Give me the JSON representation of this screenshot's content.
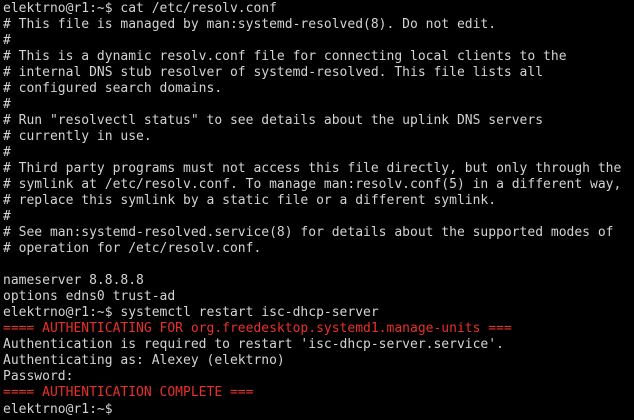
{
  "terminal": {
    "lines": [
      {
        "text": "elektrno@r1:~$ cat /etc/resolv.conf",
        "color": "#d3d3d3"
      },
      {
        "text": "# This file is managed by man:systemd-resolved(8). Do not edit.",
        "color": "#d3d3d3"
      },
      {
        "text": "#",
        "color": "#d3d3d3"
      },
      {
        "text": "# This is a dynamic resolv.conf file for connecting local clients to the",
        "color": "#d3d3d3"
      },
      {
        "text": "# internal DNS stub resolver of systemd-resolved. This file lists all",
        "color": "#d3d3d3"
      },
      {
        "text": "# configured search domains.",
        "color": "#d3d3d3"
      },
      {
        "text": "#",
        "color": "#d3d3d3"
      },
      {
        "text": "# Run \"resolvectl status\" to see details about the uplink DNS servers",
        "color": "#d3d3d3"
      },
      {
        "text": "# currently in use.",
        "color": "#d3d3d3"
      },
      {
        "text": "#",
        "color": "#d3d3d3"
      },
      {
        "text": "# Third party programs must not access this file directly, but only through the",
        "color": "#d3d3d3"
      },
      {
        "text": "# symlink at /etc/resolv.conf. To manage man:resolv.conf(5) in a different way,",
        "color": "#d3d3d3"
      },
      {
        "text": "# replace this symlink by a static file or a different symlink.",
        "color": "#d3d3d3"
      },
      {
        "text": "#",
        "color": "#d3d3d3"
      },
      {
        "text": "# See man:systemd-resolved.service(8) for details about the supported modes of",
        "color": "#d3d3d3"
      },
      {
        "text": "# operation for /etc/resolv.conf.",
        "color": "#d3d3d3"
      },
      {
        "text": "",
        "color": "#d3d3d3"
      },
      {
        "text": "nameserver 8.8.8.8",
        "color": "#d3d3d3"
      },
      {
        "text": "options edns0 trust-ad",
        "color": "#d3d3d3"
      },
      {
        "text": "elektrno@r1:~$ systemctl restart isc-dhcp-server",
        "color": "#d3d3d3"
      },
      {
        "text": "==== AUTHENTICATING FOR org.freedesktop.systemd1.manage-units ===",
        "color": "#e8302a"
      },
      {
        "text": "Authentication is required to restart 'isc-dhcp-server.service'.",
        "color": "#d3d3d3"
      },
      {
        "text": "Authenticating as: Alexey (elektrno)",
        "color": "#d3d3d3"
      },
      {
        "text": "Password:",
        "color": "#d3d3d3"
      },
      {
        "text": "==== AUTHENTICATION COMPLETE ===",
        "color": "#e8302a"
      },
      {
        "text": "elektrno@r1:~$ ",
        "color": "#d3d3d3"
      }
    ]
  },
  "colors": {
    "background": "#000000",
    "foreground": "#d3d3d3",
    "alert": "#e8302a"
  }
}
